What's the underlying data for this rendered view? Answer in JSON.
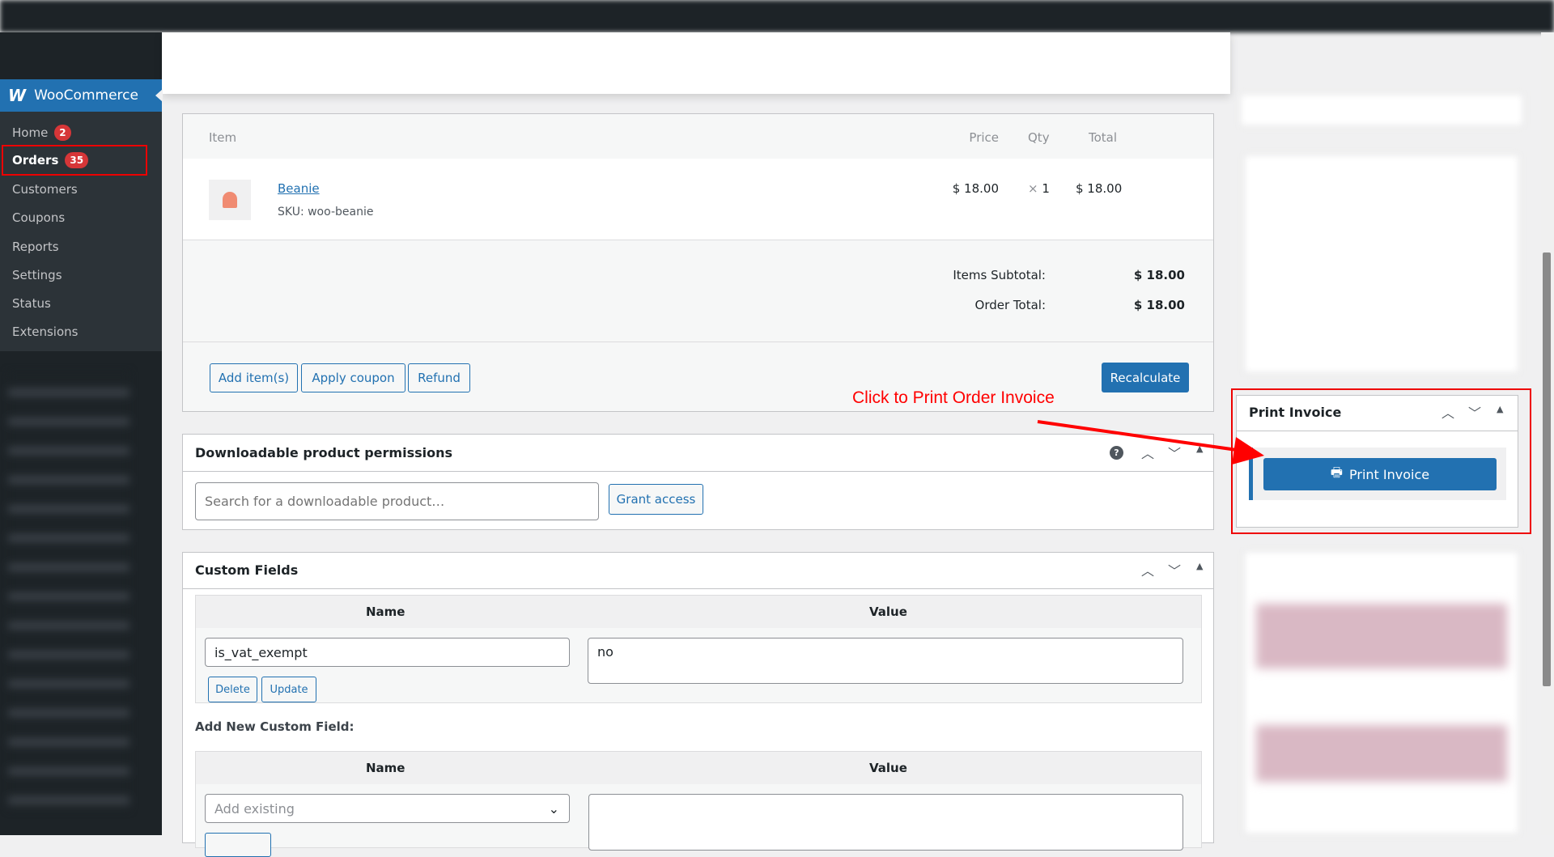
{
  "sidebar": {
    "brand": "WooCommerce",
    "items": [
      {
        "label": "Home",
        "badge": "2"
      },
      {
        "label": "Orders",
        "badge": "35"
      },
      {
        "label": "Customers"
      },
      {
        "label": "Coupons"
      },
      {
        "label": "Reports"
      },
      {
        "label": "Settings"
      },
      {
        "label": "Status"
      },
      {
        "label": "Extensions"
      }
    ]
  },
  "items_box": {
    "headers": {
      "item": "Item",
      "price": "Price",
      "qty": "Qty",
      "total": "Total"
    },
    "line": {
      "name": "Beanie",
      "sku_label": "SKU:",
      "sku": "woo-beanie",
      "price": "$ 18.00",
      "qty_x": "×",
      "qty": "1",
      "total": "$ 18.00"
    },
    "subtotal_label": "Items Subtotal:",
    "subtotal": "$ 18.00",
    "order_total_label": "Order Total:",
    "order_total": "$ 18.00",
    "buttons": {
      "add_items": "Add item(s)",
      "apply_coupon": "Apply coupon",
      "refund": "Refund",
      "recalculate": "Recalculate"
    }
  },
  "annotation": {
    "text": "Click to Print Order Invoice",
    "color": "#ff0000"
  },
  "downloads": {
    "title": "Downloadable product permissions",
    "search_placeholder": "Search for a downloadable product…",
    "grant": "Grant access"
  },
  "custom_fields": {
    "title": "Custom Fields",
    "name_header": "Name",
    "value_header": "Value",
    "row": {
      "name": "is_vat_exempt",
      "value": "no",
      "delete": "Delete",
      "update": "Update"
    },
    "add_new_label": "Add New Custom Field:",
    "select_placeholder": "Add existing"
  },
  "print_invoice": {
    "title": "Print Invoice",
    "button": "Print Invoice"
  },
  "colors": {
    "accent": "#2271b1",
    "sidebar": "#2c3338",
    "badge": "#d63638"
  }
}
